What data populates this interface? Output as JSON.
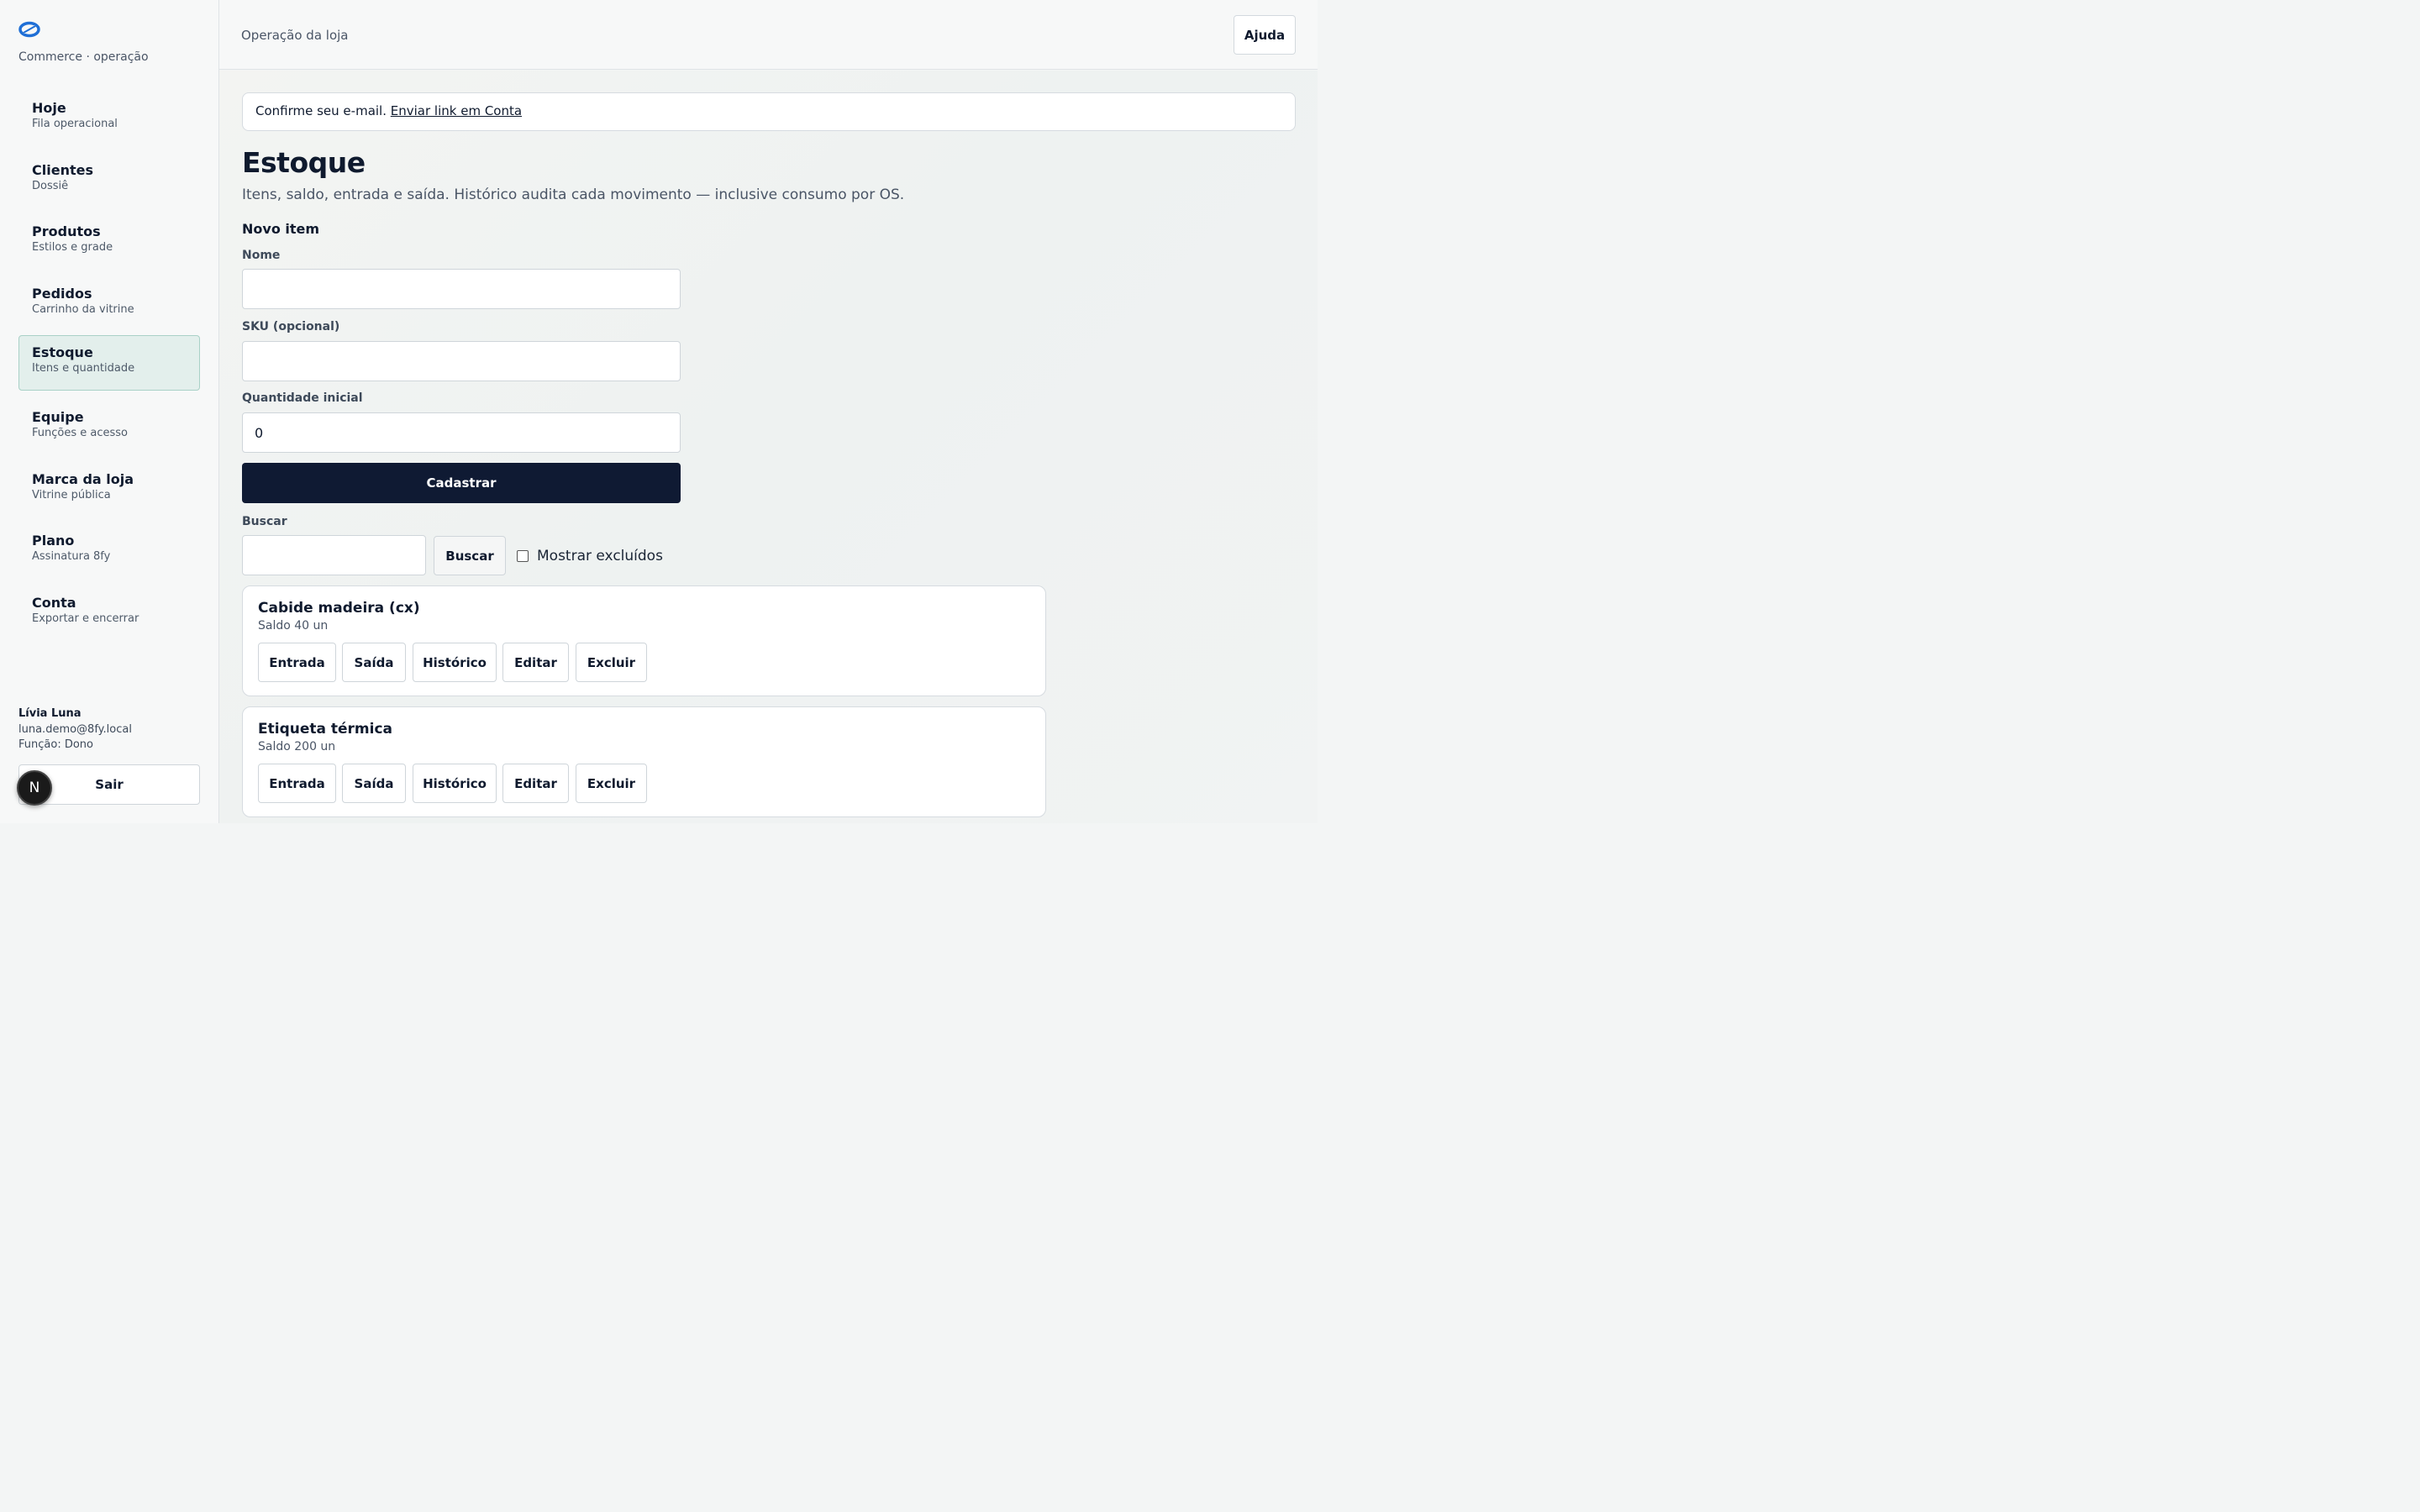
{
  "sidebar": {
    "brand": "Commerce · operação",
    "items": [
      {
        "title": "Hoje",
        "subtitle": "Fila operacional"
      },
      {
        "title": "Clientes",
        "subtitle": "Dossiê"
      },
      {
        "title": "Produtos",
        "subtitle": "Estilos e grade"
      },
      {
        "title": "Pedidos",
        "subtitle": "Carrinho da vitrine"
      },
      {
        "title": "Estoque",
        "subtitle": "Itens e quantidade"
      },
      {
        "title": "Equipe",
        "subtitle": "Funções e acesso"
      },
      {
        "title": "Marca da loja",
        "subtitle": "Vitrine pública"
      },
      {
        "title": "Plano",
        "subtitle": "Assinatura 8fy"
      },
      {
        "title": "Conta",
        "subtitle": "Exportar e encerrar"
      }
    ],
    "active_item": "Estoque",
    "user": {
      "name": "Lívia Luna",
      "email": "luna.demo@8fy.local",
      "role": "Função: Dono"
    },
    "logout_label": "Sair",
    "badge_letter": "N"
  },
  "topbar": {
    "title": "Operação da loja",
    "help_label": "Ajuda"
  },
  "alert": {
    "text": "Confirme seu e-mail.",
    "link_text": "Enviar link em Conta"
  },
  "page": {
    "title": "Estoque",
    "subtitle": "Itens, saldo, entrada e saída. Histórico audita cada movimento — inclusive consumo por OS."
  },
  "form": {
    "section_title": "Novo item",
    "name_label": "Nome",
    "name_value": "",
    "sku_label": "SKU (opcional)",
    "sku_value": "",
    "qty_label": "Quantidade inicial",
    "qty_value": "0",
    "submit_label": "Cadastrar"
  },
  "search": {
    "label": "Buscar",
    "value": "",
    "button_label": "Buscar",
    "show_deleted_label": "Mostrar excluídos",
    "show_deleted_checked": false
  },
  "items": [
    {
      "name": "Cabide madeira (cx)",
      "balance": "Saldo 40 un"
    },
    {
      "name": "Etiqueta térmica",
      "balance": "Saldo 200 un"
    }
  ],
  "item_actions": {
    "entry": "Entrada",
    "exit": "Saída",
    "history": "Histórico",
    "edit": "Editar",
    "delete": "Excluir"
  },
  "colors": {
    "primary": "#0f1a33",
    "active_nav_bg": "#e3efec",
    "active_nav_border": "#a9d1c7",
    "logo": "#1f6fd6"
  }
}
